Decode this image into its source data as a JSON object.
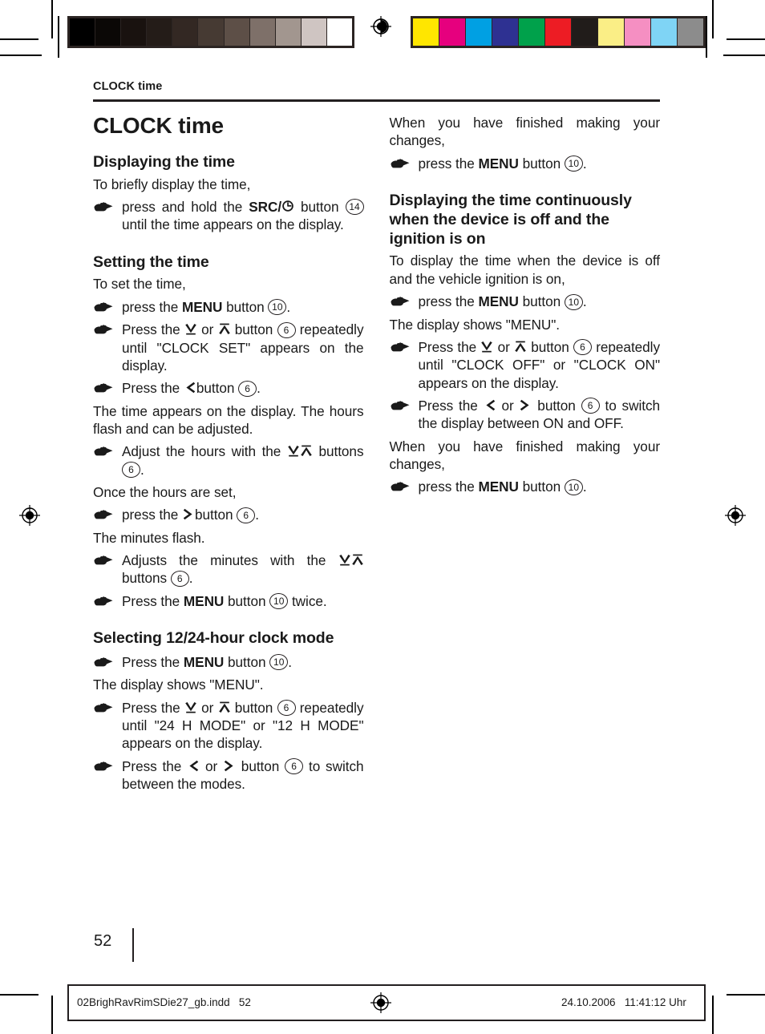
{
  "running_head": "CLOCK time",
  "page_number": "52",
  "calibration": {
    "gray_swatches": [
      "#000000",
      "#0b0806",
      "#19120f",
      "#241c18",
      "#332823",
      "#463a33",
      "#5d4f47",
      "#7e7069",
      "#a2968f",
      "#cfc5c2",
      "#ffffff"
    ],
    "color_swatches": [
      "#ffe600",
      "#e6007e",
      "#00a0e3",
      "#2e3192",
      "#00a14b",
      "#ed1c24",
      "#211c1a",
      "#faee86",
      "#f58fc2",
      "#7fd4f5",
      "#8c8c8c"
    ]
  },
  "left_column": {
    "title": "CLOCK time",
    "sections": [
      {
        "heading": "Displaying the time",
        "blocks": [
          {
            "kind": "para",
            "text": "To briefly display the time,"
          },
          {
            "kind": "step",
            "text_1": "press and hold the ",
            "bold_1": "SRC/",
            "icon": "clock-power-icon",
            "text_2": " button ",
            "ref": "14",
            "text_3": " until the time appears on the display."
          }
        ]
      },
      {
        "heading": "Setting the time",
        "blocks": [
          {
            "kind": "para",
            "text": "To set the time,"
          },
          {
            "kind": "step",
            "text_1": "press the ",
            "bold_1": "MENU",
            "text_2": " button ",
            "ref": "10",
            "text_3": "."
          },
          {
            "kind": "step",
            "text_1": "Press the ",
            "key_1": "arrow-down-bar-icon",
            "text_mid": " or ",
            "key_2": "arrow-up-bar-icon",
            "text_2": " button ",
            "ref": "6",
            "text_3": " repeatedly until \"CLOCK SET\" appears on the display."
          },
          {
            "kind": "step",
            "text_1": "Press the ",
            "key_1": "arrow-left-icon",
            "text_2": "button ",
            "ref": "6",
            "text_3": "."
          },
          {
            "kind": "para",
            "text": "The time appears on the display. The hours flash and can be adjusted."
          },
          {
            "kind": "step",
            "text_1": "Adjust the hours with the ",
            "key_1": "arrow-down-bar-icon",
            "key_2": "arrow-up-bar-icon",
            "text_2": " buttons ",
            "ref": "6",
            "text_3": "."
          },
          {
            "kind": "para",
            "text": "Once the hours are set,"
          },
          {
            "kind": "step",
            "text_1": "press the ",
            "key_1": "arrow-right-icon",
            "text_2": "button ",
            "ref": "6",
            "text_3": "."
          },
          {
            "kind": "para",
            "text": "The minutes flash."
          },
          {
            "kind": "step",
            "text_1": "Adjusts the minutes with the ",
            "key_1": "arrow-down-bar-icon",
            "key_2": "arrow-up-bar-icon",
            "text_2": " buttons ",
            "ref": "6",
            "text_3": "."
          },
          {
            "kind": "step",
            "text_1": "Press the ",
            "bold_1": "MENU",
            "text_2": " button ",
            "ref": "10",
            "text_3": " twice."
          }
        ]
      },
      {
        "heading": "Selecting 12/24-hour clock mode",
        "blocks": [
          {
            "kind": "step",
            "text_1": "Press the ",
            "bold_1": "MENU",
            "text_2": " button ",
            "ref": "10",
            "text_3": "."
          },
          {
            "kind": "para",
            "text": "The display shows \"MENU\"."
          },
          {
            "kind": "step",
            "text_1": "Press the ",
            "key_1": "arrow-down-bar-icon",
            "text_mid": " or ",
            "key_2": "arrow-up-bar-icon",
            "text_2": " button ",
            "ref": "6",
            "text_3": " repeatedly until \"24 H MODE\" or \"12 H MODE\" appears on the display."
          },
          {
            "kind": "step",
            "text_1": "Press the ",
            "key_1": "arrow-left-icon",
            "text_mid": " or ",
            "key_2": "arrow-right-icon",
            "text_2": " button ",
            "ref": "6",
            "text_3": " to switch between the modes."
          }
        ]
      }
    ]
  },
  "right_column": {
    "sections": [
      {
        "heading": null,
        "blocks": [
          {
            "kind": "para",
            "text": "When you have finished making your changes,"
          },
          {
            "kind": "step",
            "text_1": "press the ",
            "bold_1": "MENU",
            "text_2": " button ",
            "ref": "10",
            "text_3": "."
          }
        ]
      },
      {
        "heading": "Displaying the time continuously when the device is off and the ignition is on",
        "blocks": [
          {
            "kind": "para",
            "text": "To display the time when the device is off and the vehicle ignition is on,"
          },
          {
            "kind": "step",
            "text_1": "press the ",
            "bold_1": "MENU",
            "text_2": " button ",
            "ref": "10",
            "text_3": "."
          },
          {
            "kind": "para",
            "text": "The display shows \"MENU\"."
          },
          {
            "kind": "step",
            "text_1": "Press the ",
            "key_1": "arrow-down-bar-icon",
            "text_mid": " or ",
            "key_2": "arrow-up-bar-icon",
            "text_2": " button ",
            "ref": "6",
            "text_3": " repeatedly until \"CLOCK OFF\" or \"CLOCK ON\" appears on the display."
          },
          {
            "kind": "step",
            "text_1": "Press the ",
            "key_1": "arrow-left-icon",
            "text_mid": " or ",
            "key_2": "arrow-right-icon",
            "text_2": " button ",
            "ref": "6",
            "text_3": " to switch the display between ON and OFF."
          },
          {
            "kind": "para",
            "text": "When you have finished making your changes,"
          },
          {
            "kind": "step",
            "text_1": "press the ",
            "bold_1": "MENU",
            "text_2": " button ",
            "ref": "10",
            "text_3": "."
          }
        ]
      }
    ]
  },
  "footer": {
    "file_name": "02BrighRavRimSDie27_gb.indd",
    "file_page": "52",
    "date": "24.10.2006",
    "time": "11:41:12 Uhr"
  }
}
